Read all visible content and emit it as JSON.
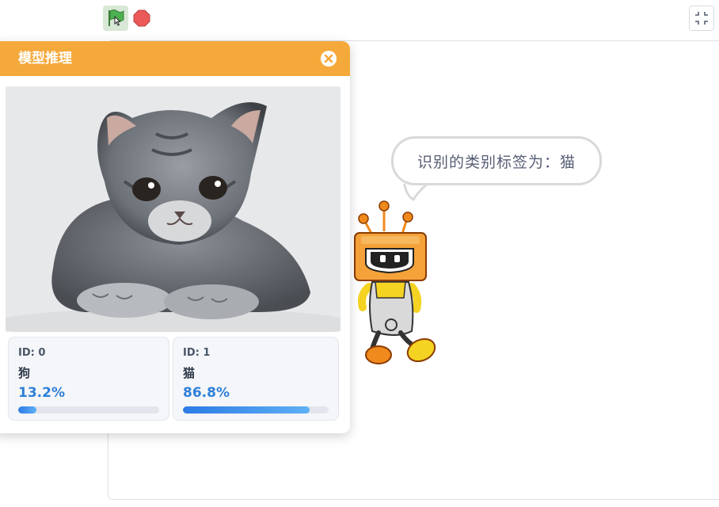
{
  "panel": {
    "title": "模型推理",
    "results": [
      {
        "id_text": "ID: 0",
        "label": "狗",
        "percent_text": "13.2%",
        "value": 0.132
      },
      {
        "id_text": "ID: 1",
        "label": "猫",
        "percent_text": "86.8%",
        "value": 0.868
      }
    ]
  },
  "speech": {
    "text": "识别的类别标签为：猫"
  },
  "icons": {
    "run": "green-flag-icon",
    "stop": "stop-icon",
    "fullscreen": "exit-fullscreen-icon",
    "close": "close-icon"
  },
  "colors": {
    "header": "#f5a93b",
    "accent_blue": "#2f7fd8",
    "flag_green": "#4caf50",
    "stop_red": "#ec5959"
  }
}
